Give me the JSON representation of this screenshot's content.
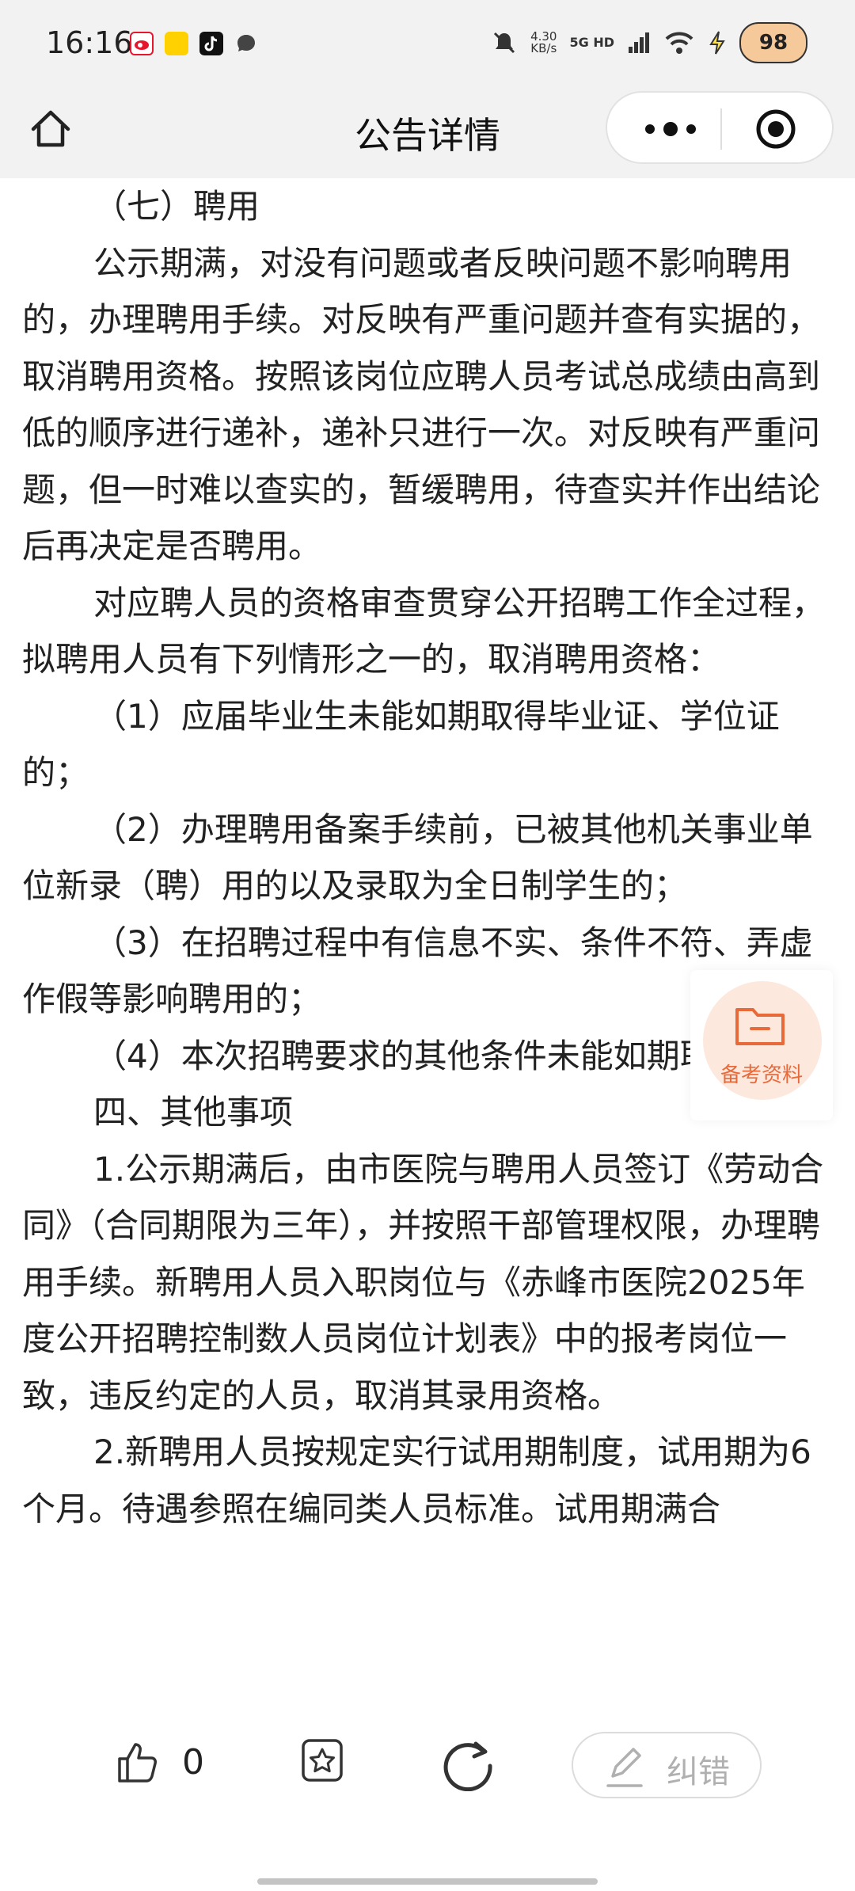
{
  "status_bar": {
    "time": "16:16",
    "speed_value": "4.30",
    "speed_unit": "KB/s",
    "network": "5G HD",
    "battery": "98",
    "app_icons": [
      "weibo-icon",
      "meituan-icon",
      "tiktok-icon",
      "message-icon"
    ]
  },
  "nav": {
    "title": "公告详情",
    "home_icon": "home-icon",
    "more_icon": "more-icon",
    "close_icon": "target-icon"
  },
  "article": {
    "paragraphs": [
      "（七）聘用",
      "公示期满，对没有问题或者反映问题不影响聘用的，办理聘用手续。对反映有严重问题并查有实据的，取消聘用资格。按照该岗位应聘人员考试总成绩由高到低的顺序进行递补，递补只进行一次。对反映有严重问题，但一时难以查实的，暂缓聘用，待查实并作出结论后再决定是否聘用。",
      "对应聘人员的资格审查贯穿公开招聘工作全过程，拟聘用人员有下列情形之一的，取消聘用资格：",
      "（1）应届毕业生未能如期取得毕业证、学位证的；",
      "（2）办理聘用备案手续前，已被其他机关事业单位新录（聘）用的以及录取为全日制学生的；",
      "（3）在招聘过程中有信息不实、条件不符、弄虚作假等影响聘用的；",
      "（4）本次招聘要求的其他条件未能如期取得的。",
      "四、其他事项",
      "1.公示期满后，由市医院与聘用人员签订《劳动合同》（合同期限为三年），并按照干部管理权限，办理聘用手续。新聘用人员入职岗位与《赤峰市医院2025年度公开招聘控制数人员岗位计划表》中的报考岗位一致，违反约定的人员，取消其录用资格。",
      "2.新聘用人员按规定实行试用期制度，试用期为6个月。待遇参照在编同类人员标准。试用期满合"
    ]
  },
  "float_button": {
    "label": "备考资料",
    "icon": "folder-icon"
  },
  "bottom_bar": {
    "like_count": "0",
    "correct_label": "纠错",
    "like_icon": "thumbs-up-icon",
    "favorite_icon": "favorite-star-icon",
    "share_icon": "share-icon",
    "correct_icon": "edit-pen-icon"
  },
  "colors": {
    "accent": "#e86a3a",
    "bar_bg": "#f2f2f2",
    "text": "#222222"
  }
}
